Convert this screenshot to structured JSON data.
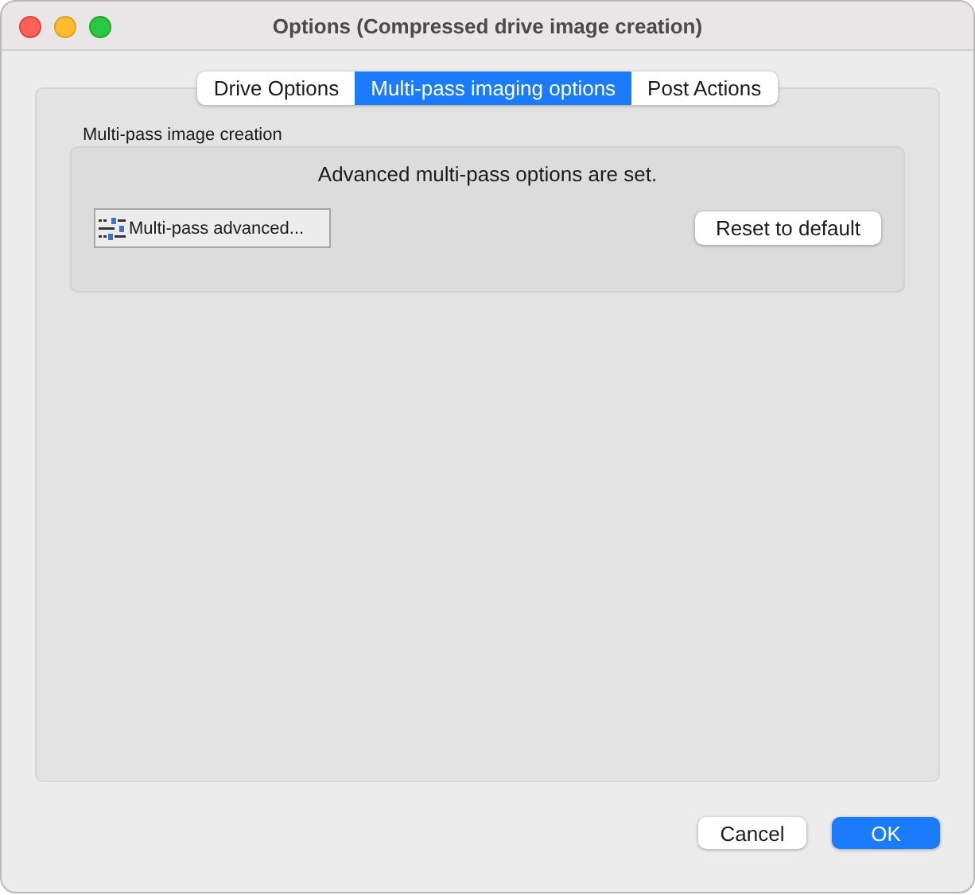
{
  "window": {
    "title": "Options (Compressed drive image creation)"
  },
  "tabs": [
    {
      "label": "Drive Options",
      "selected": false
    },
    {
      "label": "Multi-pass imaging options",
      "selected": true
    },
    {
      "label": "Post Actions",
      "selected": false
    }
  ],
  "group": {
    "title": "Multi-pass image creation",
    "message": "Advanced multi-pass options are set.",
    "advanced_button": "Multi-pass advanced...",
    "reset_button": "Reset to default"
  },
  "buttons": [
    {
      "label": "Cancel",
      "kind": "normal"
    },
    {
      "label": "OK",
      "kind": "default"
    }
  ]
}
